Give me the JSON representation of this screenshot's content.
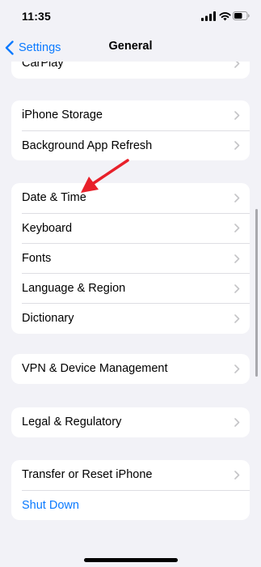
{
  "status": {
    "time": "11:35"
  },
  "nav": {
    "back_label": "Settings",
    "title": "General"
  },
  "groups": [
    {
      "items": [
        {
          "label": "CarPlay"
        }
      ]
    },
    {
      "items": [
        {
          "label": "iPhone Storage"
        },
        {
          "label": "Background App Refresh"
        }
      ]
    },
    {
      "items": [
        {
          "label": "Date & Time"
        },
        {
          "label": "Keyboard"
        },
        {
          "label": "Fonts"
        },
        {
          "label": "Language & Region"
        },
        {
          "label": "Dictionary"
        }
      ]
    },
    {
      "items": [
        {
          "label": "VPN & Device Management"
        }
      ]
    },
    {
      "items": [
        {
          "label": "Legal & Regulatory"
        }
      ]
    },
    {
      "items": [
        {
          "label": "Transfer or Reset iPhone"
        },
        {
          "label": "Shut Down"
        }
      ]
    }
  ],
  "colors": {
    "accent": "#0a7aff",
    "annotation_arrow": "#e8202a",
    "background": "#f2f2f7"
  },
  "icons": [
    "signal-icon",
    "wifi-icon",
    "battery-icon",
    "chevron-left-icon",
    "chevron-right-icon"
  ]
}
